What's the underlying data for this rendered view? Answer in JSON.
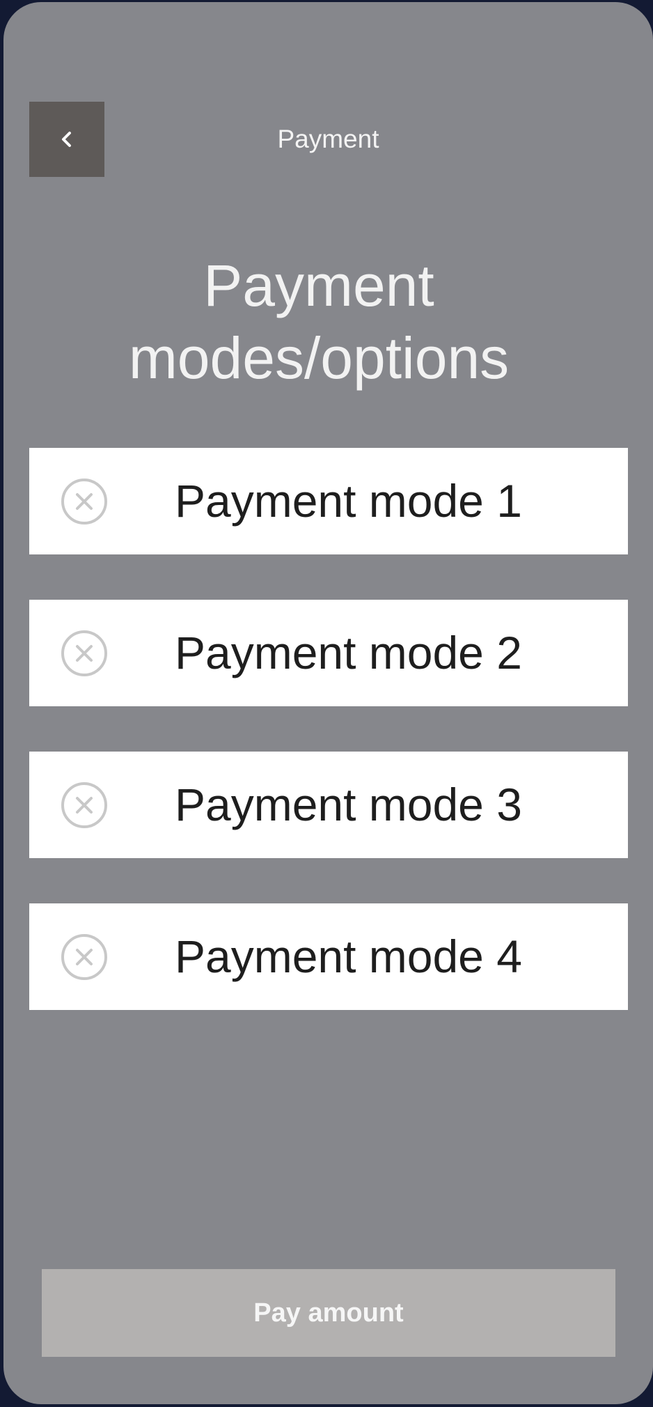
{
  "header": {
    "title": "Payment",
    "back_icon": "chevron-left-icon"
  },
  "page_title_line1": "Payment",
  "page_title_line2": "modes/options",
  "payment_modes": [
    {
      "label": "Payment mode 1",
      "icon": "close-circle-icon"
    },
    {
      "label": "Payment mode 2",
      "icon": "close-circle-icon"
    },
    {
      "label": "Payment mode 3",
      "icon": "close-circle-icon"
    },
    {
      "label": "Payment mode 4",
      "icon": "close-circle-icon"
    }
  ],
  "pay_button_label": "Pay amount",
  "colors": {
    "background": "#86878c",
    "back_button": "#5e5a58",
    "card": "#ffffff",
    "pay_button": "#b3b1b0",
    "icon_stroke": "#c8c8c8"
  }
}
